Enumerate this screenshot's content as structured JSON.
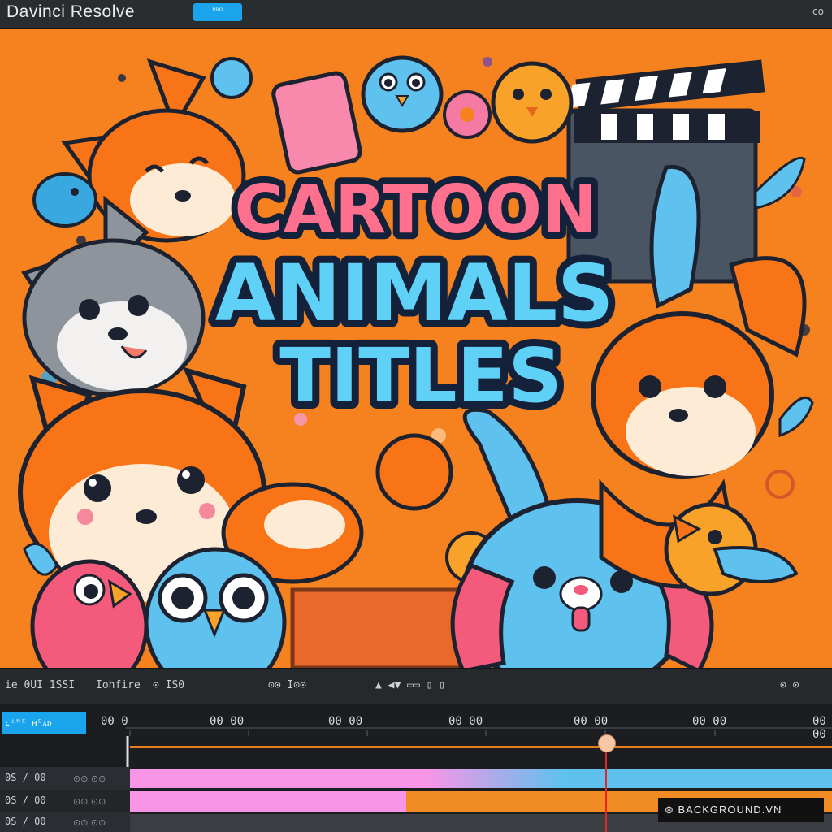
{
  "app": {
    "title": "Davinci Resolve",
    "badge": "ᴾᴿᴼ",
    "window_controls": "co"
  },
  "viewer": {
    "title_lines": [
      "CARTOON",
      "ANIMALS",
      "TITLES"
    ],
    "colors": {
      "background": "#f5821f",
      "line1_fill": "#ff6f8e",
      "line23_fill": "#5fd1f7",
      "outline": "#13213a"
    }
  },
  "toolbar": {
    "left_text_1": "ie 0UI 1SSI",
    "left_text_2": "Iohfire",
    "icons_text_1": "⊙ IS0",
    "icons_text_2": "⊙⊙ I⊙⊙",
    "center_icons": "▲  ◀▼  ▭▭  ▯  ▯",
    "right_icons": "⊙  ⊙"
  },
  "timeline": {
    "track_header_label": "ʟⁱᴹᴱ ʜᴱᴀᴅ",
    "ruler": [
      "00 0",
      "00 00",
      "00 00",
      "00 00",
      "00 00",
      "00 00",
      "00 00"
    ],
    "tracks": [
      {
        "label": "0S / 00",
        "icons": "⊙⊙  ⊙⊙"
      },
      {
        "label": "0S / 00",
        "icons": "⊙⊙  ⊙⊙"
      },
      {
        "label": "0S / 00",
        "icons": "⊙⊙  ⊙⊙"
      }
    ],
    "colors": {
      "pink_clip": "#f995e6",
      "blue_clip": "#5ec1ee",
      "orange_clip": "#f08a22",
      "playhead": "#e3262a",
      "track_bar": "#e87f1c"
    }
  },
  "watermark": {
    "text": "⊛ BACKGROUND.VN"
  }
}
